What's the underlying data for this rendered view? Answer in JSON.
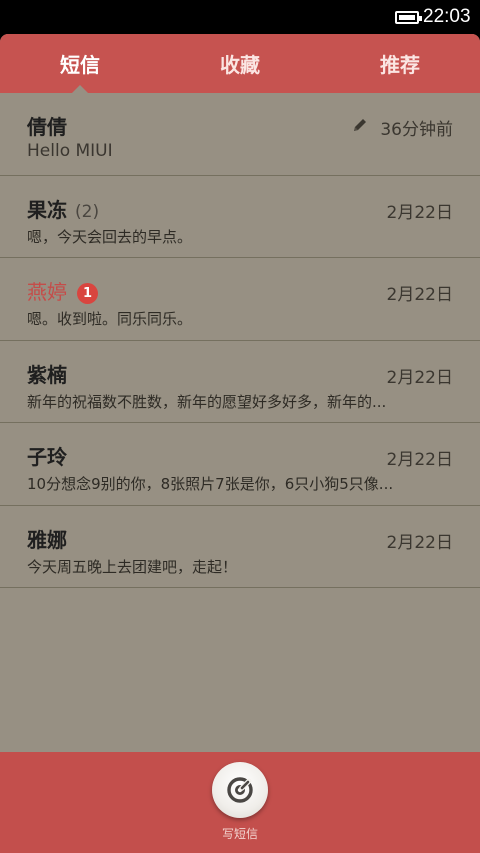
{
  "status_bar": {
    "time": "22:03"
  },
  "tabs": [
    {
      "label": "短信"
    },
    {
      "label": "收藏"
    },
    {
      "label": "推荐"
    }
  ],
  "conversations": [
    {
      "name": "倩倩",
      "count": "",
      "badge": "",
      "time": "36分钟前",
      "preview": "Hello MIUI",
      "draft": true
    },
    {
      "name": "果冻",
      "count": "(2)",
      "badge": "",
      "time": "2月22日",
      "preview": "嗯，今天会回去的早点。"
    },
    {
      "name": "燕婷",
      "count": "",
      "badge": "1",
      "time": "2月22日",
      "preview": "嗯。收到啦。同乐同乐。"
    },
    {
      "name": "紫楠",
      "count": "",
      "badge": "",
      "time": "2月22日",
      "preview": "新年的祝福数不胜数，新年的愿望好多好多，新年的..."
    },
    {
      "name": "子玲",
      "count": "",
      "badge": "",
      "time": "2月22日",
      "preview": "10分想念9别的你，8张照片7张是你，6只小狗5只像..."
    },
    {
      "name": "雅娜",
      "count": "",
      "badge": "",
      "time": "2月22日",
      "preview": "今天周五晚上去团建吧，走起！"
    }
  ],
  "compose": {
    "label": "写短信"
  },
  "colors": {
    "accent": "#c65350",
    "background": "#979083",
    "unread": "#c54c49"
  }
}
